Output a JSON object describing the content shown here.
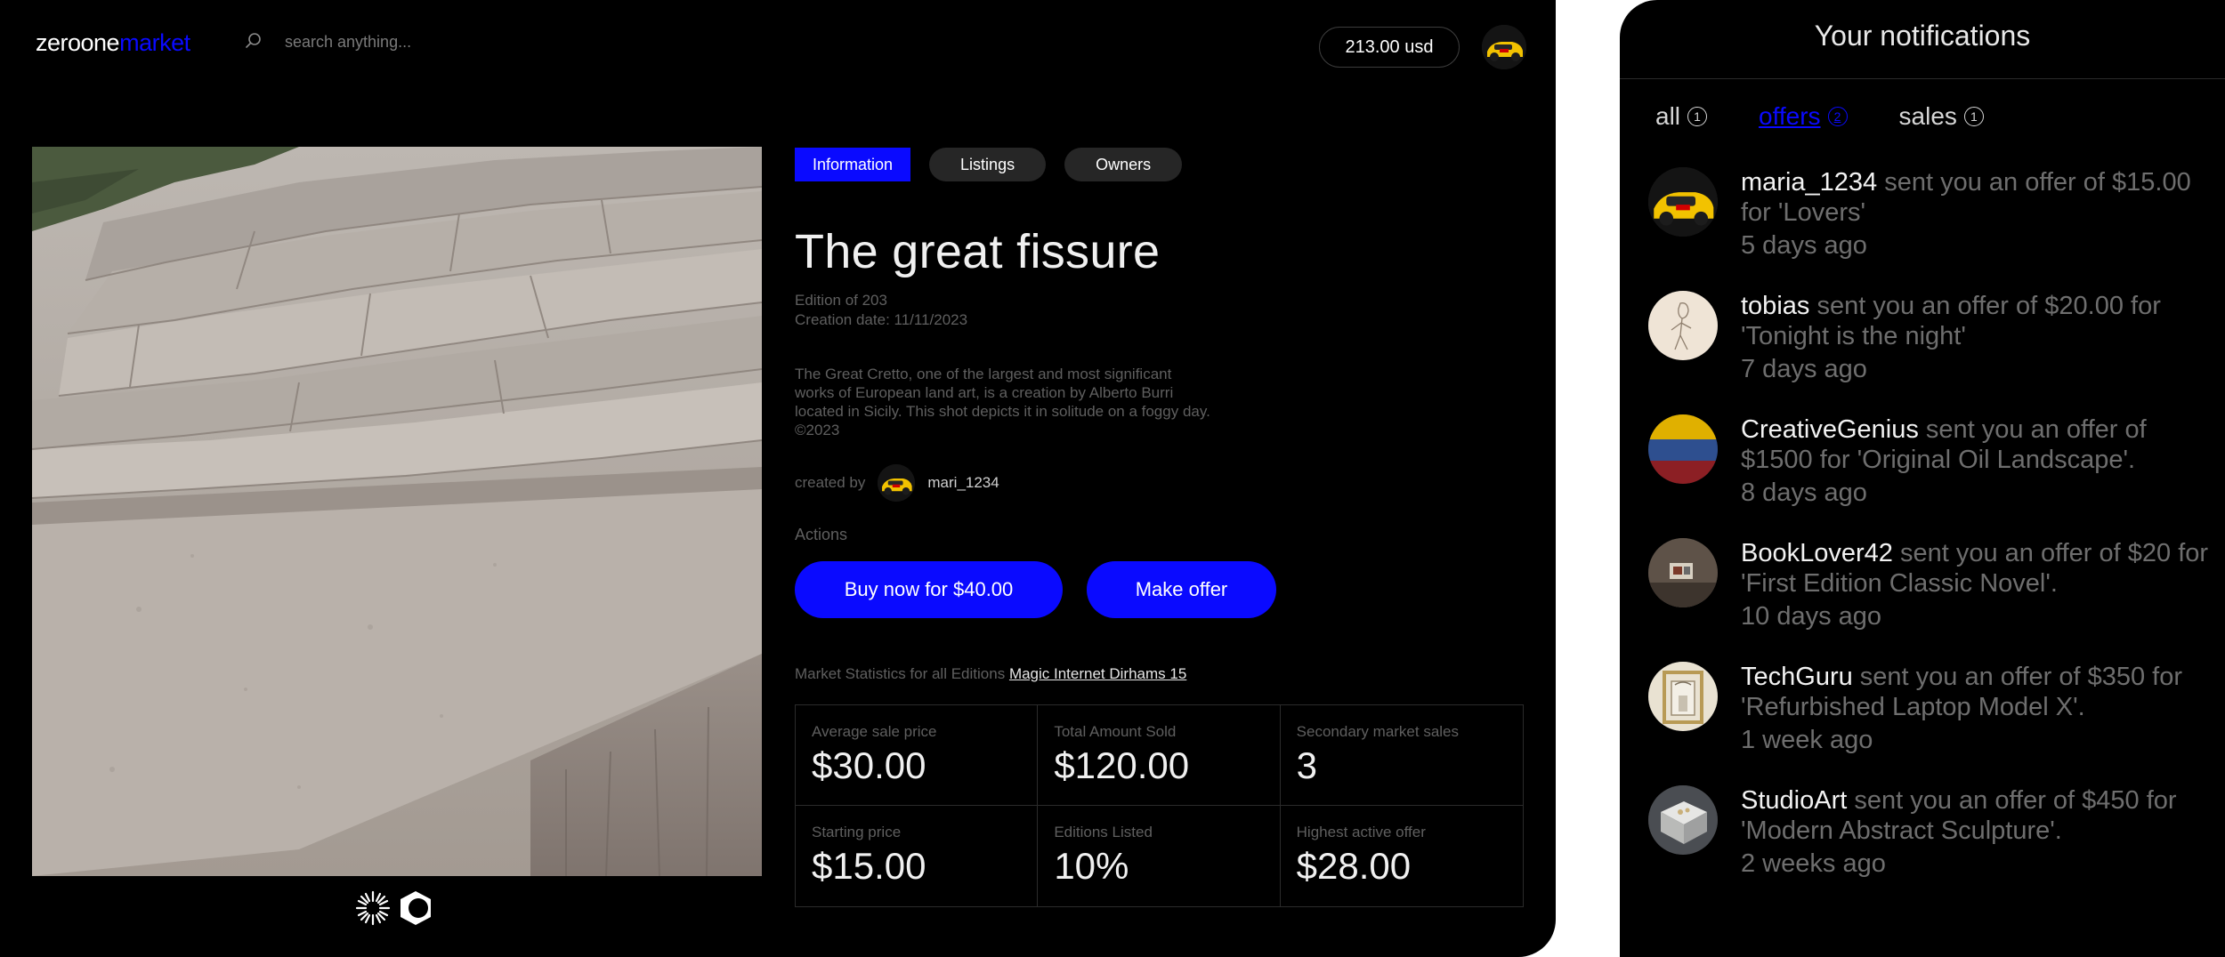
{
  "header": {
    "logo_part1": "zeroone",
    "logo_part2": "market",
    "search_placeholder": "search anything...",
    "balance": "213.00 usd",
    "search_icon": "search-icon",
    "avatar_icon": "user-avatar"
  },
  "tabs": [
    {
      "label": "Information",
      "active": true
    },
    {
      "label": "Listings",
      "active": false
    },
    {
      "label": "Owners",
      "active": false
    }
  ],
  "artwork": {
    "title": "The great fissure",
    "edition": "Edition of 203",
    "creation_date": "Creation date: 11/11/2023",
    "description": "The Great Cretto, one of the largest and most significant works of European land art, is a creation by Alberto Burri located in Sicily. This shot depicts it in solitude on a foggy day. ©2023",
    "created_by_label": "created by",
    "creator": "mari_1234"
  },
  "actions": {
    "label": "Actions",
    "buy_button": "Buy now for $40.00",
    "offer_button": "Make offer"
  },
  "stats": {
    "label": "Market Statistics for all Editions",
    "link": "Magic Internet Dirhams 15",
    "items": [
      {
        "label": "Average sale price",
        "value": "$30.00"
      },
      {
        "label": "Total Amount Sold",
        "value": "$120.00"
      },
      {
        "label": "Secondary market sales",
        "value": "3"
      },
      {
        "label": "Starting price",
        "value": "$15.00"
      },
      {
        "label": "Editions Listed",
        "value": "10%"
      },
      {
        "label": "Highest active offer",
        "value": "$28.00"
      }
    ]
  },
  "notifications": {
    "title": "Your notifications",
    "filters": [
      {
        "label": "all",
        "count": "1",
        "active": false
      },
      {
        "label": "offers",
        "count": "2",
        "active": true
      },
      {
        "label": "sales",
        "count": "1",
        "active": false
      }
    ],
    "items": [
      {
        "user": "maria_1234",
        "text": " sent you an offer of $15.00 for 'Lovers'",
        "time": "5 days ago",
        "avatar": "yellow-car"
      },
      {
        "user": "tobias",
        "text": " sent you an offer of $20.00 for 'Tonight is the night'",
        "time": "7 days ago",
        "avatar": "sketch"
      },
      {
        "user": "CreativeGenius",
        "text": " sent you an offer of $1500 for 'Original Oil Landscape'.",
        "time": "8 days ago",
        "avatar": "flag"
      },
      {
        "user": "BookLover42",
        "text": " sent you an offer of $20 for 'First Edition Classic Novel'.",
        "time": "10 days ago",
        "avatar": "room"
      },
      {
        "user": "TechGuru",
        "text": " sent you an offer of $350 for 'Refurbished Laptop Model X'.",
        "time": "1 week ago",
        "avatar": "framed-door"
      },
      {
        "user": "StudioArt",
        "text": " sent you an offer of $450 for 'Modern Abstract Sculpture'.",
        "time": "2 weeks ago",
        "avatar": "sculpture-box"
      }
    ]
  },
  "colors": {
    "accent": "#0a0aff",
    "background": "#000000",
    "muted_text": "#5f5f5f"
  }
}
